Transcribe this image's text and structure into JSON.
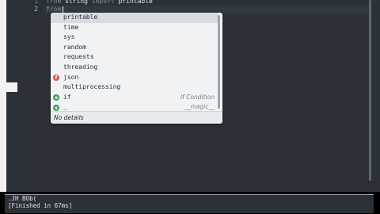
{
  "editor": {
    "line_numbers": [
      "1",
      "2"
    ],
    "lines": [
      {
        "keyword": "from",
        "rest": " string ",
        "keyword2": "import",
        "rest2": " printable"
      },
      {
        "keyword": "from",
        "rest": " ",
        "keyword2": "",
        "rest2": ""
      }
    ]
  },
  "autocomplete": {
    "items": [
      {
        "label": "printable",
        "kind": "",
        "hint": ""
      },
      {
        "label": "time",
        "kind": "",
        "hint": ""
      },
      {
        "label": "sys",
        "kind": "",
        "hint": ""
      },
      {
        "label": "random",
        "kind": "",
        "hint": ""
      },
      {
        "label": "requests",
        "kind": "",
        "hint": ""
      },
      {
        "label": "threading",
        "kind": "",
        "hint": ""
      },
      {
        "label": "json",
        "kind": "f",
        "hint": ""
      },
      {
        "label": "multiprocessing",
        "kind": "",
        "hint": ""
      },
      {
        "label": "if",
        "kind": "s",
        "hint": "If Condition"
      },
      {
        "label": "_",
        "kind": "s",
        "hint": "__magic__"
      }
    ],
    "selected_index": 0,
    "details": "No details"
  },
  "output": {
    "lines": [
      ".JH BOb(",
      "[Finished in 67ms]"
    ]
  },
  "colors": {
    "background": "#2b3137",
    "badge_f": "#d9534f",
    "badge_s": "#3f9a57"
  }
}
